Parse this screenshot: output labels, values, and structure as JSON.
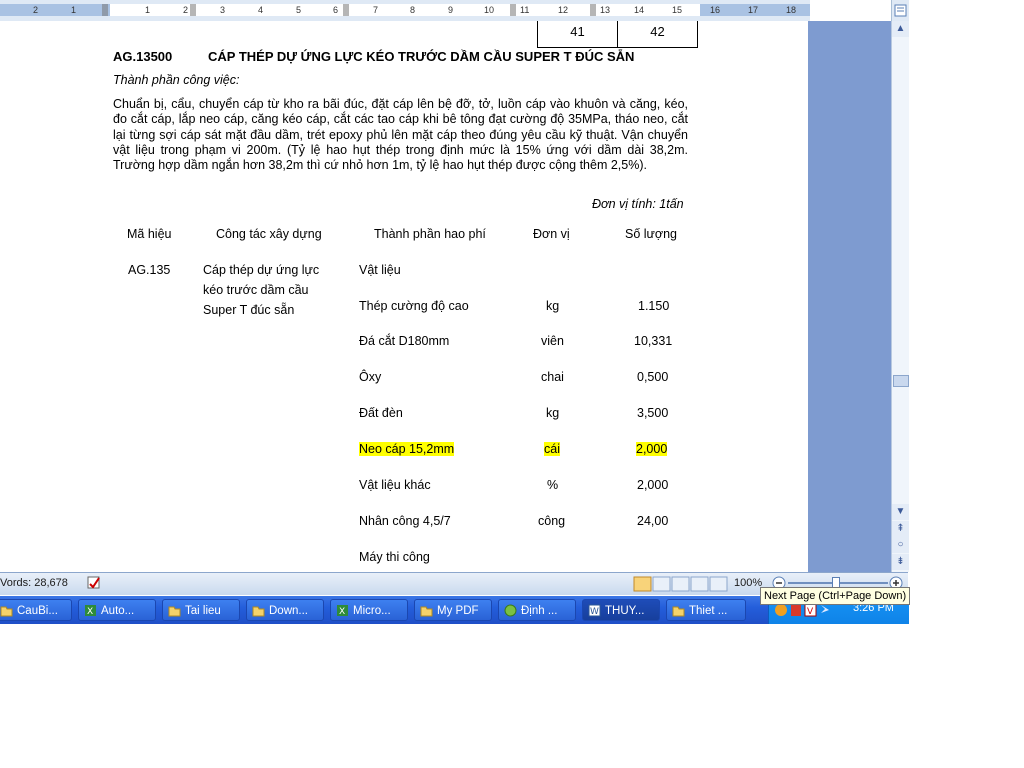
{
  "ruler": {
    "numbers": [
      "2",
      "1",
      "1",
      "2",
      "3",
      "4",
      "5",
      "6",
      "7",
      "8",
      "9",
      "10",
      "11",
      "12",
      "13",
      "14",
      "15",
      "16",
      "17",
      "18"
    ]
  },
  "top_table": {
    "cells": [
      "41",
      "42"
    ]
  },
  "section": {
    "code": "AG.13500",
    "title": "CÁP THÉP DỰ ỨNG LỰC KÉO TRƯỚC DẦM CẦU SUPER T ĐÚC SẴN",
    "work_label": "Thành phần công việc:",
    "description": "Chuẩn bị, cẩu, chuyển cáp từ kho ra bãi đúc, đặt cáp lên bệ đỡ, tở, luồn cáp vào khuôn và căng, kéo, đo cắt cáp, lắp neo cáp, căng kéo cáp, cắt các tao cáp khi bê tông đạt cường độ 35MPa, tháo neo, cắt lại từng sợi cáp sát mặt đầu dầm, trét epoxy phủ lên mặt cáp theo đúng yêu cầu kỹ thuật. Vận chuyển vật liệu trong phạm vi 200m. (Tỷ lệ hao hụt thép trong định mức là 15% ứng với dầm dài 38,2m. Trường hợp dầm ngắn hơn 38,2m thì cứ nhỏ hơn 1m, tỷ lệ hao hụt thép được cộng thêm 2,5%).",
    "unit_note": "Đơn vị tính: 1tấn"
  },
  "table": {
    "headers": [
      "Mã hiệu",
      "Công tác xây dựng",
      "Thành phần hao phí",
      "Đơn vị",
      "Số lượng"
    ],
    "code": "AG.135",
    "work_lines": [
      "Cáp thép dự ứng lực",
      "kéo trước dầm cầu",
      "Super T đúc sẵn"
    ],
    "rows": [
      {
        "item": "Vật liệu",
        "unit": "",
        "qty": ""
      },
      {
        "item": "Thép cường độ cao",
        "unit": "kg",
        "qty": "1.150"
      },
      {
        "item": "Đá cắt D180mm",
        "unit": "viên",
        "qty": "10,331"
      },
      {
        "item": "Ôxy",
        "unit": "chai",
        "qty": "0,500"
      },
      {
        "item": "Đất đèn",
        "unit": "kg",
        "qty": "3,500"
      },
      {
        "item": "Neo cáp 15,2mm",
        "unit": "cái",
        "qty": "2,000"
      },
      {
        "item": "Vật liệu khác",
        "unit": "%",
        "qty": "2,000"
      },
      {
        "item": "Nhân công 4,5/7",
        "unit": "công",
        "qty": "24,00"
      },
      {
        "item": "Máy thi công",
        "unit": "",
        "qty": ""
      }
    ],
    "highlight_color": "#ffff00"
  },
  "status": {
    "words": "Vords: 28,678",
    "zoom": "100%"
  },
  "tooltip": "Next Page (Ctrl+Page Down)",
  "taskbar": {
    "tasks": [
      {
        "label": "CauBi...",
        "icon": "folder-icon"
      },
      {
        "label": "Auto...",
        "icon": "excel-icon"
      },
      {
        "label": "Tai lieu",
        "icon": "folder-icon"
      },
      {
        "label": "Down...",
        "icon": "folder-icon"
      },
      {
        "label": "Micro...",
        "icon": "excel-icon"
      },
      {
        "label": "My PDF",
        "icon": "folder-icon"
      },
      {
        "label": "Định ...",
        "icon": "app-icon"
      },
      {
        "label": "THUY...",
        "icon": "word-icon"
      },
      {
        "label": "Thiet ...",
        "icon": "folder-icon"
      }
    ],
    "active_index": 7,
    "clock": "3:26 PM"
  }
}
